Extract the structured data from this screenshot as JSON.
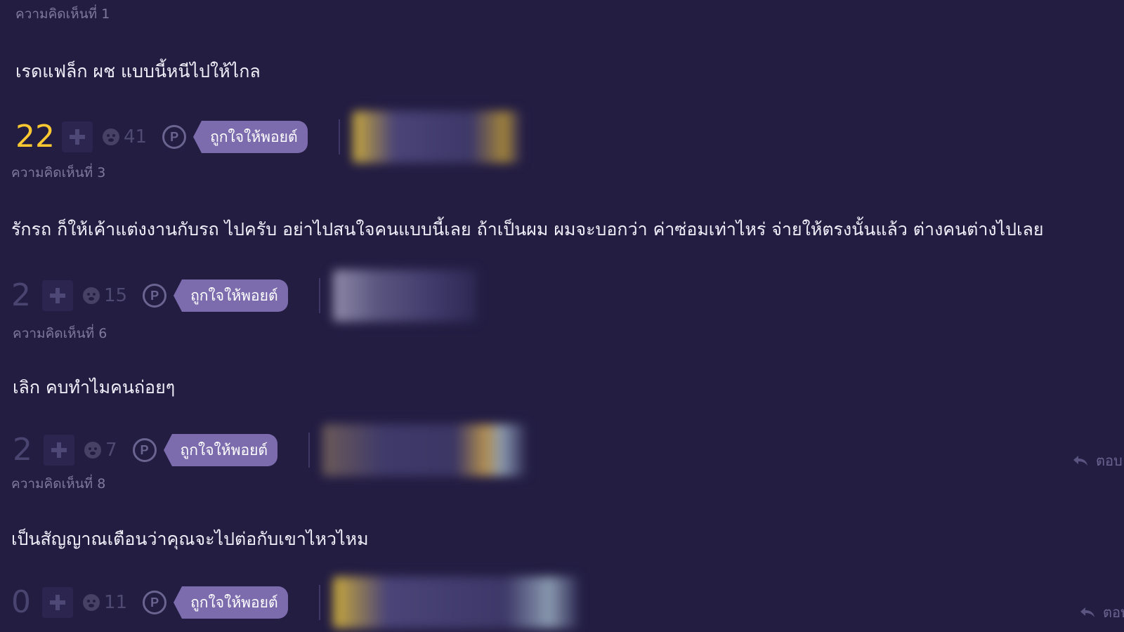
{
  "comments": [
    {
      "label": "ความคิดเห็นที่ 1",
      "text": "เรดแฟล็ก ผช แบบนี้หนีไปให้ไกล",
      "score": "22",
      "emotion_count": "41",
      "like_label": "ถูกใจให้พอยต์"
    },
    {
      "label": "ความคิดเห็นที่ 3",
      "text": "รักรถ ก็ให้เค้าแต่งงานกับรถ ไปครับ อย่าไปสนใจคนแบบนี้เลย ถ้าเป็นผม ผมจะบอกว่า ค่าซ่อมเท่าไหร่ จ่ายให้ตรงนั้นแล้ว ต่างคนต่างไปเลย",
      "score": "2",
      "emotion_count": "15",
      "like_label": "ถูกใจให้พอยต์"
    },
    {
      "label": "ความคิดเห็นที่ 6",
      "text": "เลิก คบทำไมคนถ่อยๆ",
      "score": "2",
      "emotion_count": "7",
      "like_label": "ถูกใจให้พอยต์",
      "reply_label": "ตอบ"
    },
    {
      "label": "ความคิดเห็นที่ 8",
      "text": "เป็นสัญญาณเตือนว่าคุณจะไปต่อกับเขาไหวไหม",
      "score": "0",
      "emotion_count": "11",
      "like_label": "ถูกใจให้พอยต์",
      "reply_label": "ตอบ"
    }
  ],
  "icons": {
    "plus": "plus-icon",
    "emotion": "emotion-face-icon",
    "point": "point-p-icon",
    "reply": "reply-arrow-icon"
  },
  "colors": {
    "background": "#231d42",
    "score_highlight": "#fbc831",
    "like_button": "#7c6cae",
    "muted_text": "#7f7a9c"
  }
}
